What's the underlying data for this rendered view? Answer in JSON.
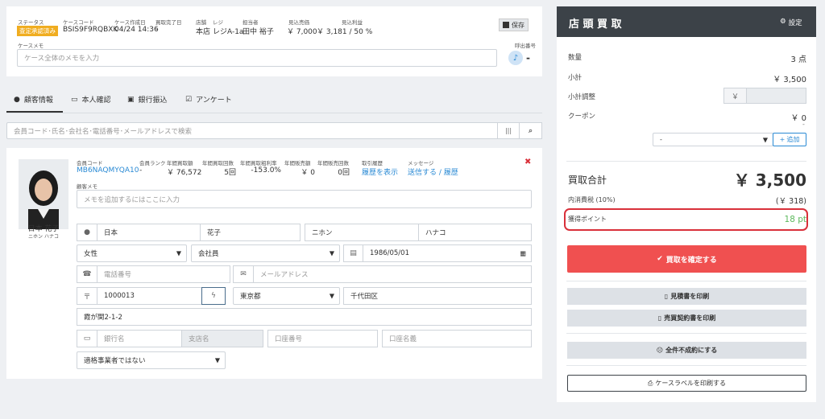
{
  "case": {
    "labels": {
      "status": "ステータス",
      "code": "ケースコード",
      "created": "ケース作成日",
      "completed": "買取完了日",
      "store": "店舗",
      "register": "レジ",
      "staff": "担当者",
      "sale_est": "見込売価",
      "profit_est": "見込利益",
      "memo": "ケースメモ",
      "call_number": "呼出番号"
    },
    "status_badge": "査定承認済み",
    "code": "BSIS9F9RQBXK",
    "created": "04/24 14:36",
    "completed": "-",
    "store": "本店",
    "register": "レジA-1a",
    "staff": "田中 裕子",
    "sale_est": "￥ 7,000",
    "profit_est": "￥ 3,181 / 50 %",
    "save_label": "保存",
    "memo_placeholder": "ケース全体のメモを入力",
    "call_number": "-"
  },
  "tabs": [
    {
      "label": "顧客情報",
      "active": true
    },
    {
      "label": "本人確認",
      "active": false
    },
    {
      "label": "銀行振込",
      "active": false
    },
    {
      "label": "アンケート",
      "active": false
    }
  ],
  "search": {
    "placeholder": "会員コード･氏名･会社名･電話番号･メールアドレスで検索"
  },
  "customer": {
    "name": "日本 花子",
    "kana": "ニホン ハナコ",
    "labels": {
      "member_code": "会員コード",
      "rank": "会員ランク",
      "annual_amount": "年間買取額",
      "annual_count": "年間買取回数",
      "annual_profit_rate": "年間買取粗利率",
      "annual_sales_amount": "年間販売額",
      "annual_sales_count": "年間販売回数",
      "history": "取引履歴",
      "message": "メッセージ",
      "customer_memo": "顧客メモ"
    },
    "member_code": "MB6NAQMYQA10",
    "rank": "-",
    "annual_amount": "￥ 76,572",
    "annual_count": "5回",
    "annual_profit_rate": "-153.0%",
    "annual_sales_amount": "￥ 0",
    "annual_sales_count": "0回",
    "history_link": "履歴を表示",
    "message_link": "送信する / 履歴",
    "memo_placeholder": "メモを追加するにはここに入力",
    "last_name": "日本",
    "first_name": "花子",
    "last_kana": "ニホン",
    "first_kana": "ハナコ",
    "gender": "女性",
    "member_type": "会社員",
    "birthday": "1986/05/01",
    "phone_placeholder": "電話番号",
    "email_placeholder": "メールアドレス",
    "postal": "1000013",
    "prefecture": "東京都",
    "city": "千代田区",
    "address": "霞が関2-1-2",
    "bank_placeholder": "銀行名",
    "branch_placeholder": "支店名",
    "account_placeholder": "口座番号",
    "holder_placeholder": "口座名義",
    "invoice": "適格事業者ではない"
  },
  "register": {
    "title": "店 頭 買 取",
    "settings": "設定",
    "qty_label": "数量",
    "qty": "3 点",
    "subtotal_label": "小計",
    "subtotal": "￥ 3,500",
    "adjust_label": "小計調整",
    "yen": "￥",
    "coupon_label": "クーポン",
    "coupon": "￥ 0",
    "coupon_dash": "-",
    "coupon_select": "-",
    "add_label": "追加",
    "total_label": "買取合計",
    "total": "￥ 3,500",
    "tax_label": "内消費税 (10%)",
    "tax": "(￥ 318)",
    "points_label": "獲得ポイント",
    "points": "18 pt",
    "confirm": "買取を確定する",
    "print_estimate": "見積書を印刷",
    "print_contract": "売買契約書を印刷",
    "fail_all": "全件不成約にする",
    "print_label": "ケースラベルを印刷する"
  },
  "colors": {
    "header": "#3c4248",
    "confirm": "#f05050",
    "link": "#2a8ad4",
    "badge": "#f0ad20",
    "points": "#5cb85c",
    "highlight": "#d9303a"
  }
}
